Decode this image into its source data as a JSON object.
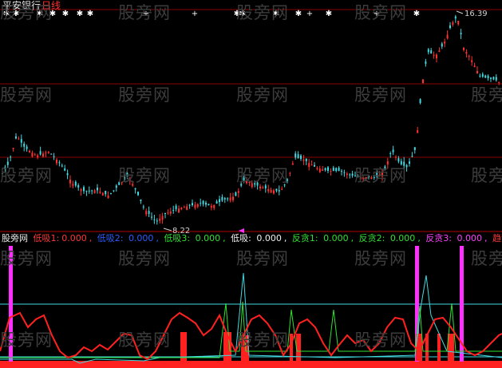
{
  "title": {
    "stock_name": "平安银行",
    "period": "日线"
  },
  "main_chart": {
    "high_label": "16.39",
    "low_label": "8.22"
  },
  "indicator": {
    "name": "股旁网",
    "items": [
      {
        "label": "低吸1:",
        "value": "0.000",
        "color": "#ff3838"
      },
      {
        "label": "低吸2:",
        "value": "0.000",
        "color": "#2a5cff"
      },
      {
        "label": "低吸3:",
        "value": "0.000",
        "color": "#30e030"
      },
      {
        "label": "低吸:",
        "value": "0.000",
        "color": "#f0f0f0"
      },
      {
        "label": "反贪1:",
        "value": "0.000",
        "color": "#30e030"
      },
      {
        "label": "反贪2:",
        "value": "0.000",
        "color": "#30e030"
      },
      {
        "label": "反贪3:",
        "value": "0.000",
        "color": "#ff40ff"
      },
      {
        "label": "趋势",
        "value": "",
        "color": "#ff3838"
      }
    ]
  },
  "watermark": "股旁网",
  "colors": {
    "up": "#ff3030",
    "down": "#40d8e0",
    "grid": "#8a0000",
    "magenta": "#ff30ff",
    "cyan": "#40d8e0",
    "green": "#30e030"
  }
}
